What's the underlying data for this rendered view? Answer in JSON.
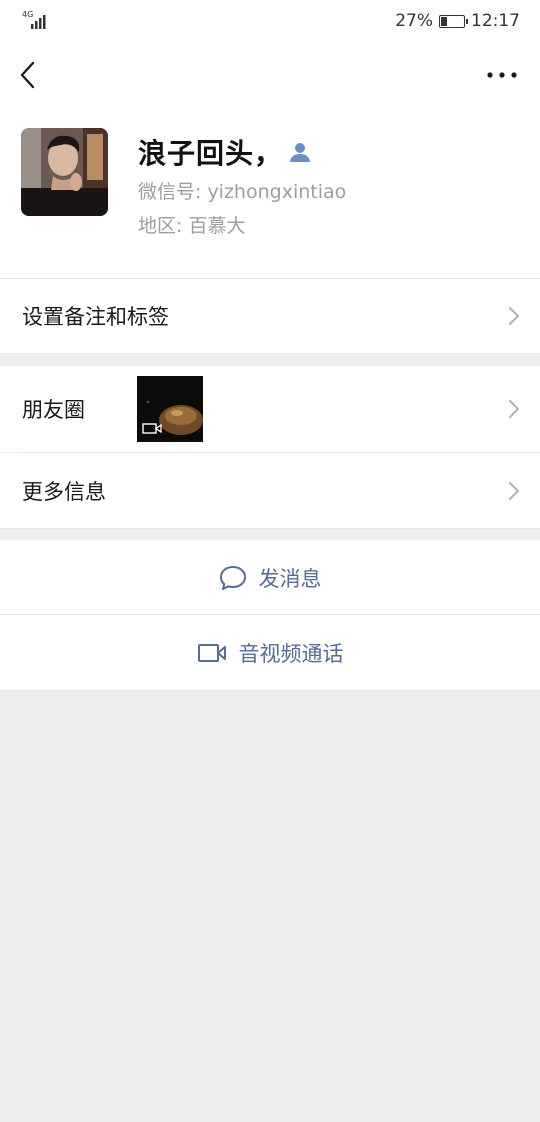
{
  "status_bar": {
    "network": "4G",
    "battery_percent": "27%",
    "battery_level": 0.27,
    "time": "12:17"
  },
  "nav": {
    "back_icon": "chevron-left-icon",
    "more_icon": "more-dots-icon"
  },
  "profile": {
    "nickname": "浪子回头，",
    "wechat_id": "微信号: yizhongxintiao",
    "region": "地区: 百慕大",
    "contact_icon": "person-icon"
  },
  "menu": {
    "remarks_label": "设置备注和标签",
    "moments_label": "朋友圈",
    "more_info_label": "更多信息"
  },
  "actions": {
    "message_label": "发消息",
    "video_call_label": "音视频通话",
    "accent_color": "#576b95"
  },
  "colors": {
    "background": "#ededed",
    "surface": "#ffffff",
    "secondary_text": "#9e9e9e"
  }
}
